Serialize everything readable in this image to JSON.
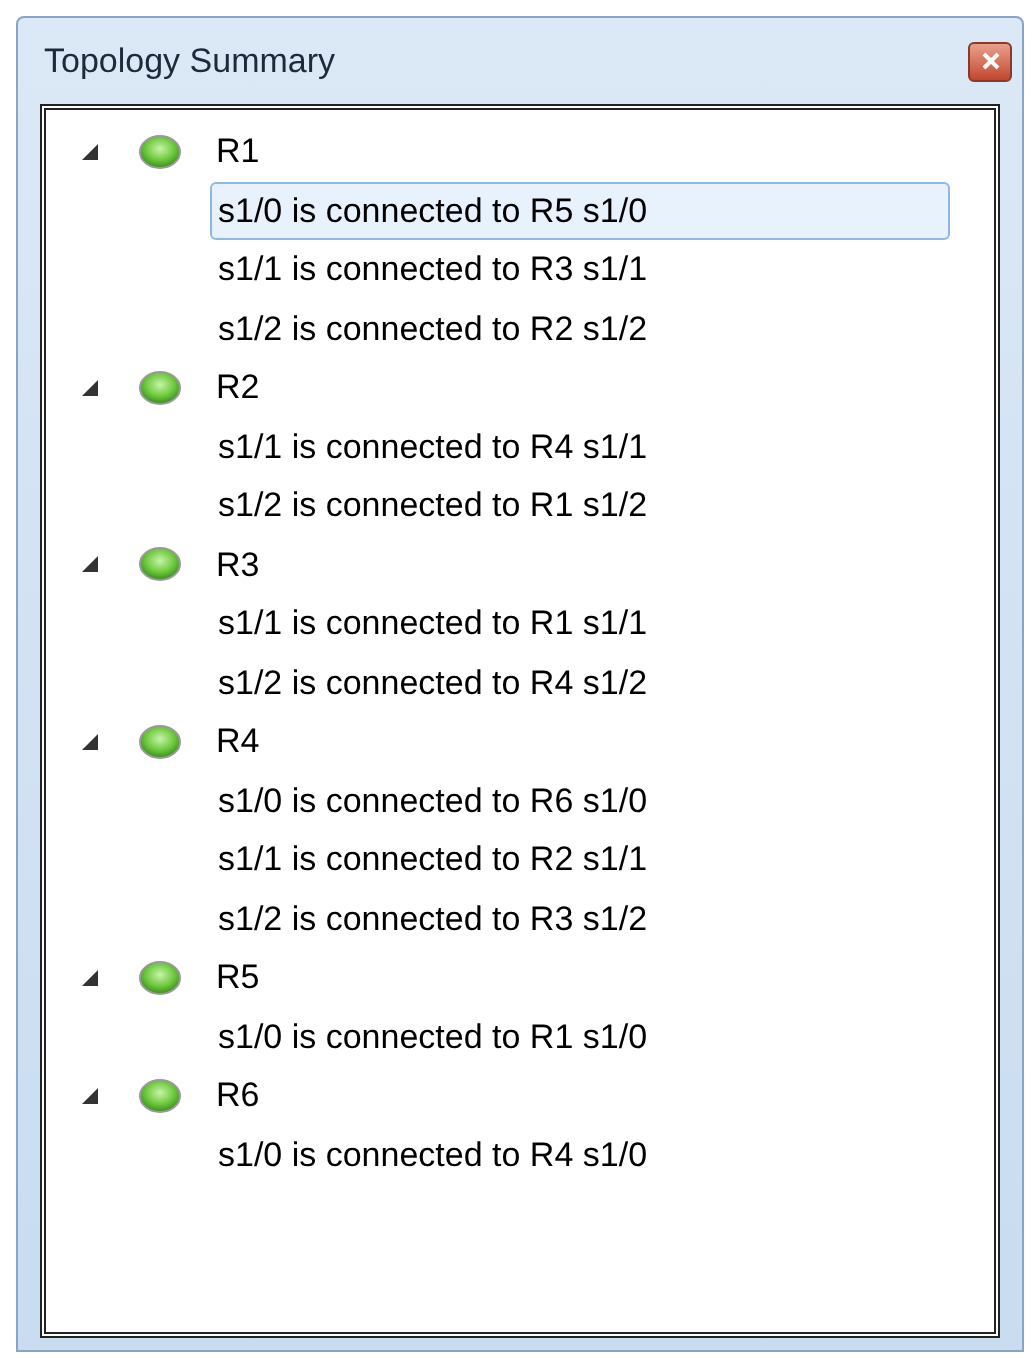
{
  "window": {
    "title": "Topology Summary"
  },
  "tree": [
    {
      "label": "R1",
      "expanded": true,
      "children": [
        {
          "label": "s1/0 is connected to R5 s1/0",
          "selected": true
        },
        {
          "label": "s1/1 is connected to R3 s1/1",
          "selected": false
        },
        {
          "label": "s1/2 is connected to R2 s1/2",
          "selected": false
        }
      ]
    },
    {
      "label": "R2",
      "expanded": true,
      "children": [
        {
          "label": "s1/1 is connected to R4 s1/1",
          "selected": false
        },
        {
          "label": "s1/2 is connected to R1 s1/2",
          "selected": false
        }
      ]
    },
    {
      "label": "R3",
      "expanded": true,
      "children": [
        {
          "label": "s1/1 is connected to R1 s1/1",
          "selected": false
        },
        {
          "label": "s1/2 is connected to R4 s1/2",
          "selected": false
        }
      ]
    },
    {
      "label": "R4",
      "expanded": true,
      "children": [
        {
          "label": "s1/0 is connected to R6 s1/0",
          "selected": false
        },
        {
          "label": "s1/1 is connected to R2 s1/1",
          "selected": false
        },
        {
          "label": "s1/2 is connected to R3 s1/2",
          "selected": false
        }
      ]
    },
    {
      "label": "R5",
      "expanded": true,
      "children": [
        {
          "label": "s1/0 is connected to R1 s1/0",
          "selected": false
        }
      ]
    },
    {
      "label": "R6",
      "expanded": true,
      "children": [
        {
          "label": "s1/0 is connected to R4 s1/0",
          "selected": false
        }
      ]
    }
  ]
}
